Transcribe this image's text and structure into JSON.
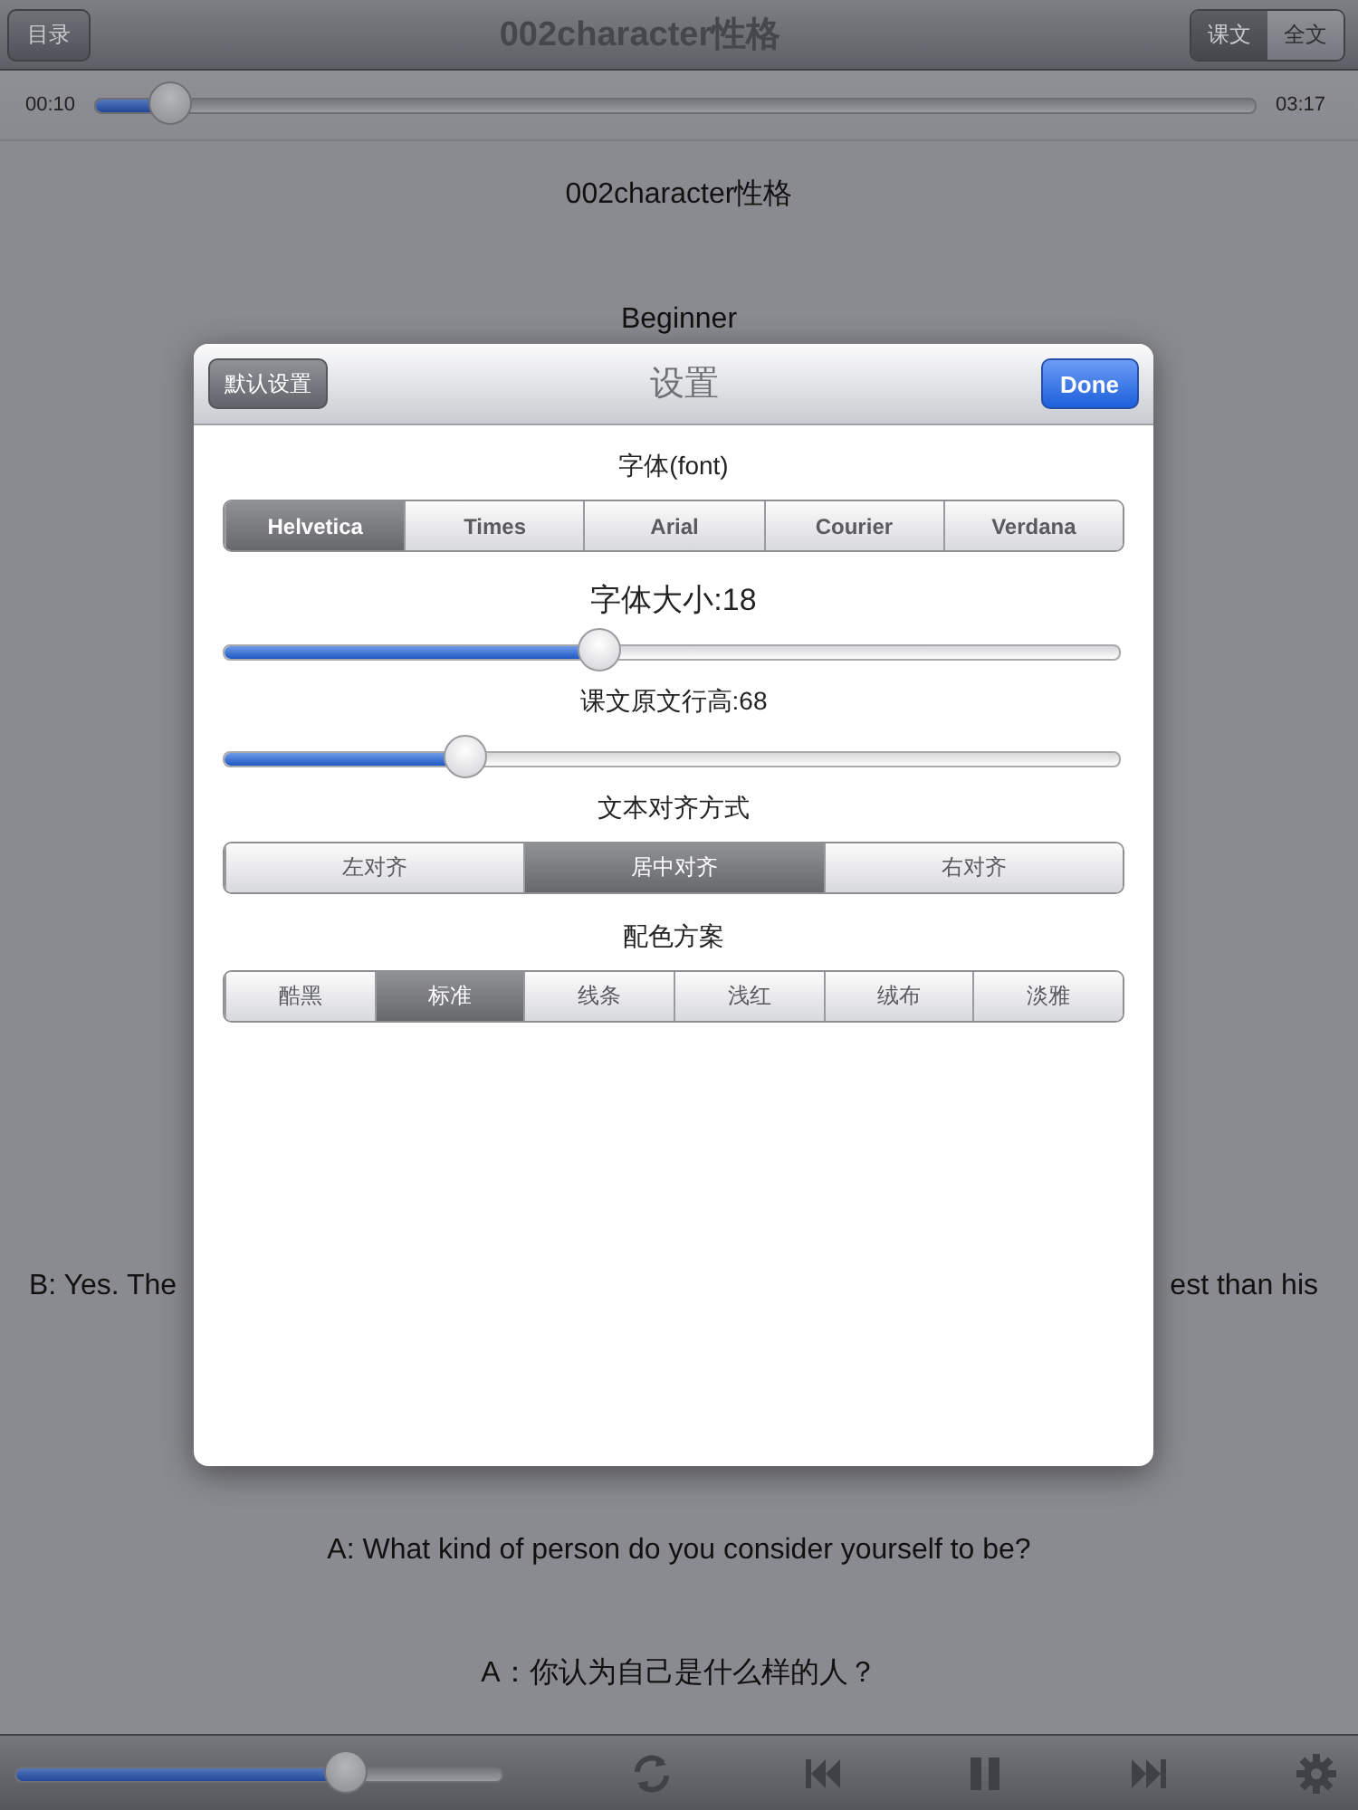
{
  "nav_bar": {
    "back_button": "目录",
    "title": "002character性格",
    "view_tabs": [
      {
        "label": "课文",
        "selected": true
      },
      {
        "label": "全文",
        "selected": false
      }
    ]
  },
  "progress": {
    "elapsed": "00:10",
    "level": 0.065,
    "total": "03:17"
  },
  "lesson_lines": [
    {
      "kind": "text",
      "text": "002character性格"
    },
    {
      "kind": "text",
      "text": "Beginner"
    },
    {
      "kind": "split",
      "left": "B: Yes. The",
      "right": "est than his"
    },
    {
      "kind": "text",
      "text": "A: What kind of person do you consider yourself to be?"
    },
    {
      "kind": "text",
      "text": "A：你认为自己是什么样的人？"
    }
  ],
  "settings": {
    "reset_button": "默认设置",
    "title": "设置",
    "done_button": "Done",
    "sections": [
      {
        "kind": "segmented",
        "label": "字体(font)",
        "options": [
          {
            "label": "Helvetica",
            "selected": true
          },
          {
            "label": "Times",
            "selected": false
          },
          {
            "label": "Arial",
            "selected": false
          },
          {
            "label": "Courier",
            "selected": false
          },
          {
            "label": "Verdana",
            "selected": false
          }
        ]
      },
      {
        "kind": "slider",
        "label": "字体大小:18",
        "level": 0.42
      },
      {
        "kind": "slider",
        "label": "课文原文行高:68",
        "level": 0.27
      },
      {
        "kind": "segmented",
        "label": "文本对齐方式",
        "options": [
          {
            "label": "左对齐",
            "selected": false
          },
          {
            "label": "居中对齐",
            "selected": true
          },
          {
            "label": "右对齐",
            "selected": false
          }
        ]
      },
      {
        "kind": "segmented",
        "label": "配色方案",
        "options": [
          {
            "label": "酷黑",
            "selected": false
          },
          {
            "label": "标准",
            "selected": true
          },
          {
            "label": "线条",
            "selected": false
          },
          {
            "label": "浅红",
            "selected": false
          },
          {
            "label": "绒布",
            "selected": false
          },
          {
            "label": "淡雅",
            "selected": false
          }
        ]
      }
    ]
  },
  "player": {
    "volume": {
      "level": 0.68
    }
  }
}
